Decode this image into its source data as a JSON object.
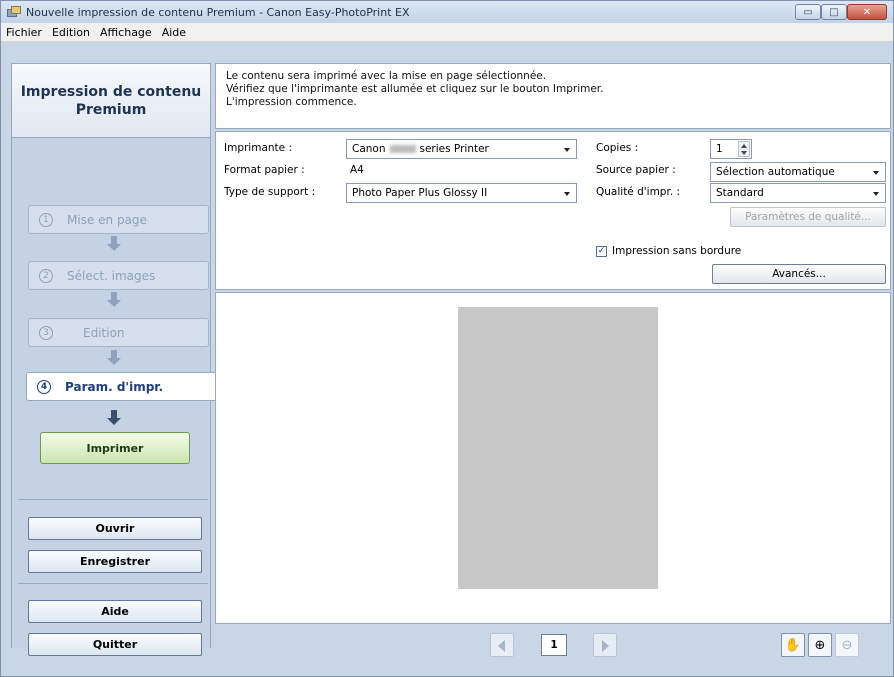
{
  "window": {
    "title": "Nouvelle impression de contenu Premium - Canon Easy-PhotoPrint EX",
    "minimize": "▭",
    "maximize": "□",
    "close": "✕"
  },
  "menu": [
    "Fichier",
    "Edition",
    "Affichage",
    "Aide"
  ],
  "sidebar": {
    "header": "Impression de contenu Premium",
    "steps": [
      {
        "num": "1",
        "label": "Mise en page"
      },
      {
        "num": "2",
        "label": "Sélect. images"
      },
      {
        "num": "3",
        "label": "Edition"
      },
      {
        "num": "4",
        "label": "Param. d'impr."
      }
    ],
    "print_label": "Imprimer",
    "open_label": "Ouvrir",
    "save_label": "Enregistrer",
    "help_label": "Aide",
    "quit_label": "Quitter"
  },
  "info": {
    "line1": "Le contenu sera imprimé avec la mise en page sélectionnée.",
    "line2": "Vérifiez que l'imprimante est allumée et cliquez sur le bouton Imprimer.",
    "line3": "L'impression commence."
  },
  "settings": {
    "printer_label": "Imprimante :",
    "printer_value_prefix": "Canon",
    "printer_value_suffix": "series Printer",
    "paper_size_label": "Format papier :",
    "paper_size_value": "A4",
    "media_type_label": "Type de support :",
    "media_type_value": "Photo Paper Plus Glossy II",
    "copies_label": "Copies :",
    "copies_value": "1",
    "paper_source_label": "Source papier :",
    "paper_source_value": "Sélection automatique",
    "quality_label": "Qualité d'impr. :",
    "quality_value": "Standard",
    "quality_settings_button": "Paramètres de qualité...",
    "borderless_label": "Impression sans bordure",
    "borderless_checked": true,
    "advanced_button": "Avancés..."
  },
  "pager": {
    "current_page": "1"
  },
  "tools": {
    "hand": "hand-icon",
    "zoom_in": "zoom-in-icon",
    "zoom_out": "zoom-out-icon"
  }
}
